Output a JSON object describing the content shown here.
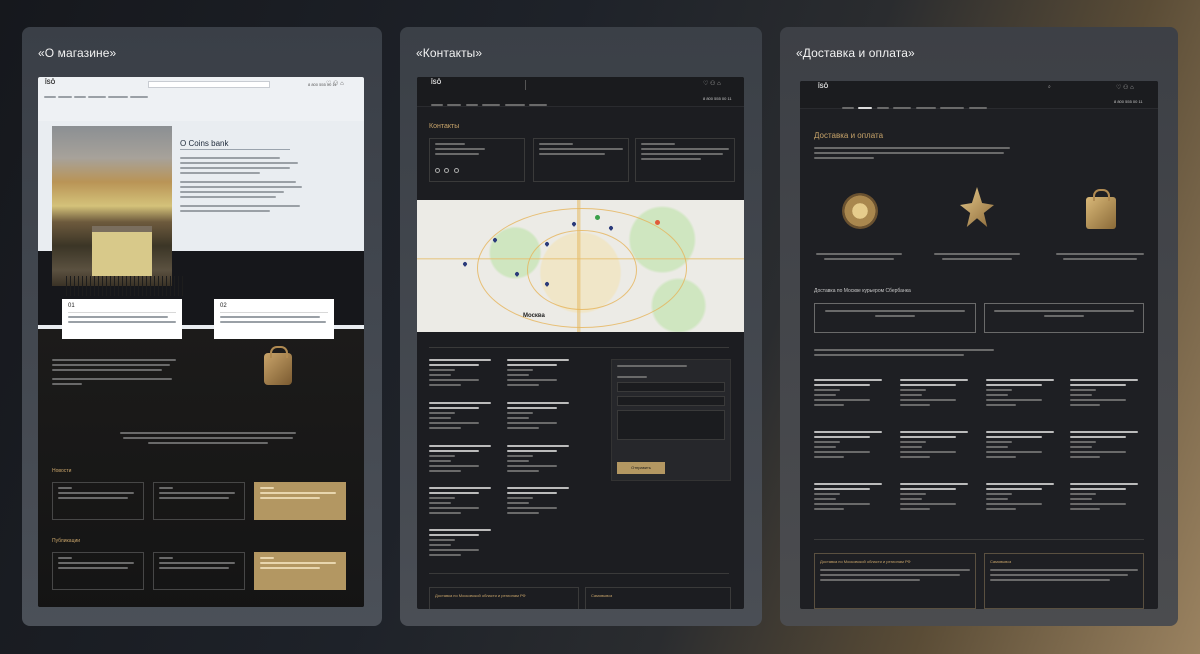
{
  "colors": {
    "accent_gold": "#c8a46a",
    "dark_bg": "#1c1d21",
    "panel_bg": "#3a3f47",
    "light_bg": "#e9edf1"
  },
  "panels": [
    {
      "title": "«О магазине»"
    },
    {
      "title": "«Контакты»"
    },
    {
      "title": "«Доставка и оплата»"
    }
  ],
  "about": {
    "header_phone": "8 800 555 00 11",
    "heading": "О Coins bank",
    "card1_num": "01",
    "card2_num": "02",
    "news_heading": "Новости",
    "publications_heading": "Публикации"
  },
  "contacts": {
    "header_phone": "8 800 555 00 11",
    "heading": "Контакты",
    "map_city": "Москва",
    "form_button": "Отправить",
    "bottom_left": "Доставка по Московской области и регионам РФ",
    "bottom_right": "Самовывоз"
  },
  "delivery": {
    "header_phone": "8 800 555 00 11",
    "heading": "Доставка и оплата",
    "courier_heading": "Доставка по Москве курьером Сбербанка",
    "bottom_left": "Доставка по Московской области и регионам РФ",
    "bottom_right": "Самовывоз"
  }
}
